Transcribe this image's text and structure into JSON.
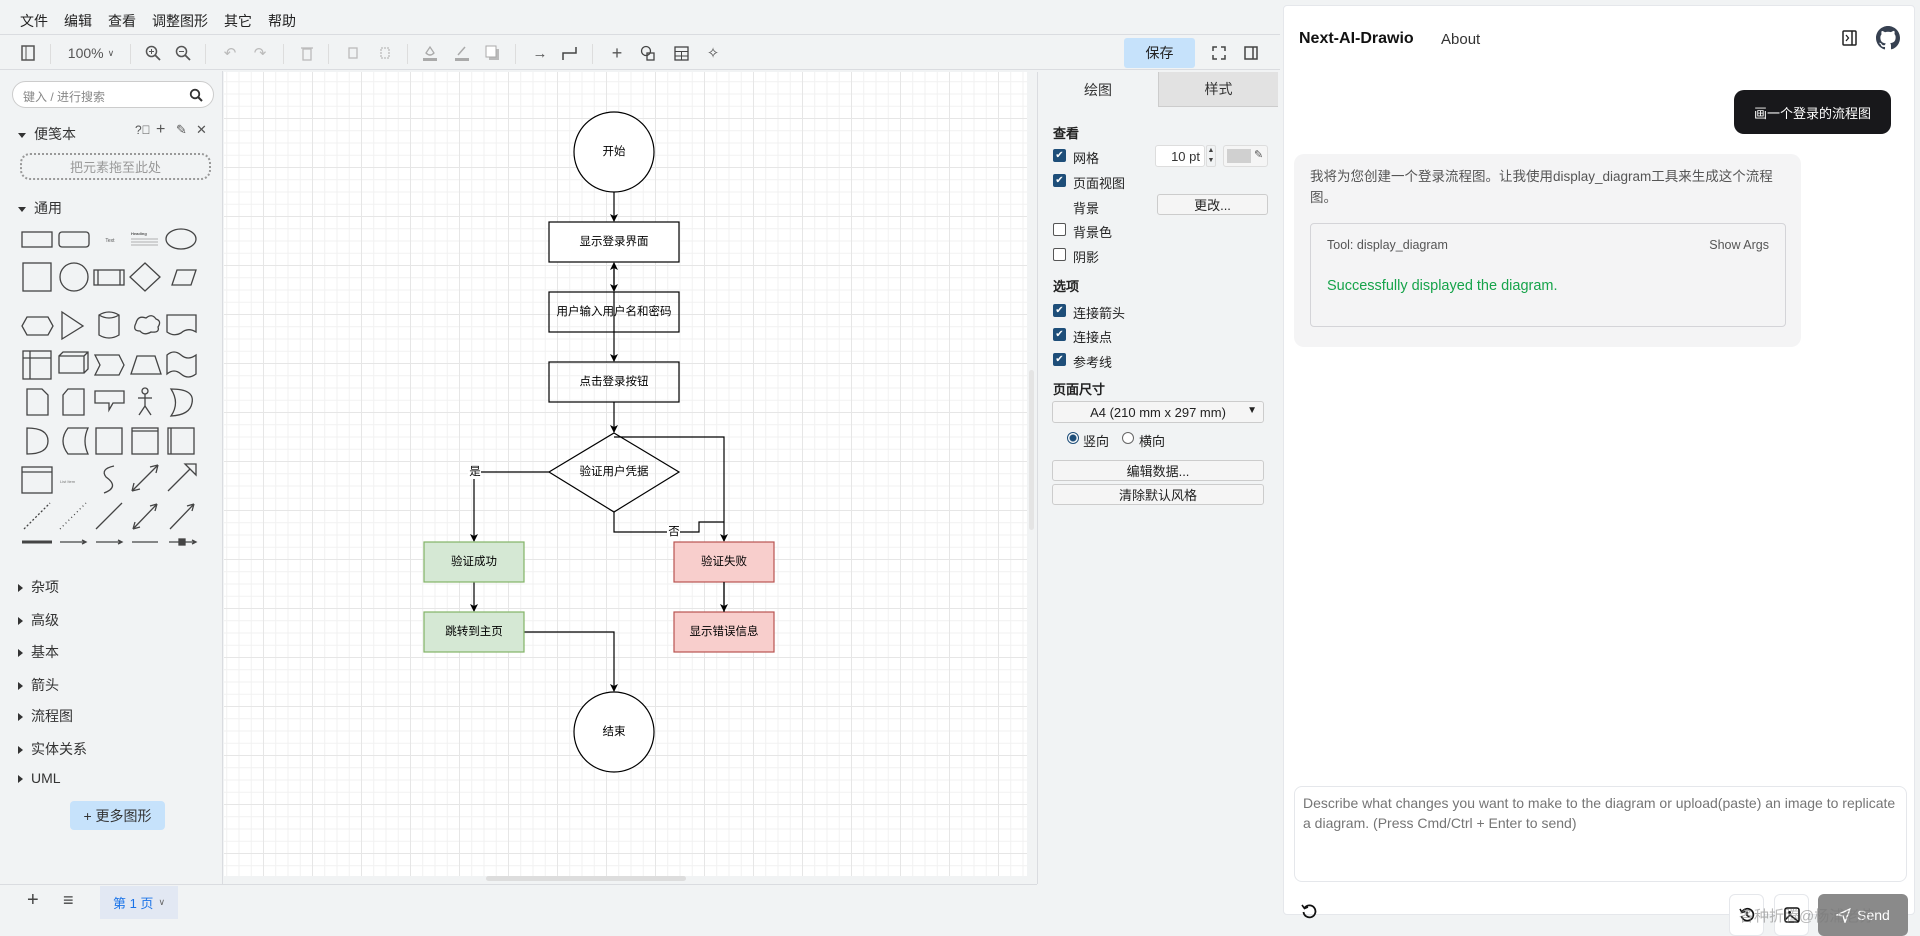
{
  "menu": [
    "文件",
    "编辑",
    "查看",
    "调整图形",
    "其它",
    "帮助"
  ],
  "toolbar": {
    "zoom": "100%",
    "save_label": "保存",
    "icons": [
      "sidebar-toggle-icon",
      "zoom-in-icon",
      "zoom-out-icon",
      "undo-icon",
      "redo-icon",
      "delete-icon",
      "to-front-icon",
      "to-back-icon",
      "fill-color-icon",
      "line-color-icon",
      "shadow-icon",
      "connection-arrow-icon",
      "waypoint-icon",
      "insert-icon",
      "shapes-icon",
      "table-icon",
      "ai-sparkle-icon",
      "fullscreen-icon",
      "format-panel-icon"
    ]
  },
  "sidebar": {
    "search_placeholder": "键入 / 进行搜索",
    "scratchpad": "便笺本",
    "dropzone": "把元素拖至此处",
    "general": "通用",
    "palette_text": "Text",
    "palette_heading": "Heading",
    "palette_list_item": "List Item",
    "collapsed_sections": [
      "杂项",
      "高级",
      "基本",
      "箭头",
      "流程图",
      "实体关系",
      "UML"
    ],
    "more_shapes": "+ 更多图形"
  },
  "footer": {
    "page_tab": "第 1 页"
  },
  "diagram": {
    "nodes": {
      "start": "开始",
      "show_login": "显示登录界面",
      "input_credentials": "用户输入用户名和密码",
      "click_login": "点击登录按钮",
      "verify": "验证用户凭据",
      "success": "验证成功",
      "goto_home": "跳转到主页",
      "fail": "验证失败",
      "show_error": "显示错误信息",
      "end": "结束"
    },
    "edge_labels": {
      "yes": "是",
      "no": "否"
    },
    "colors": {
      "success_fill": "#d5e8d4",
      "success_stroke": "#82b366",
      "fail_fill": "#f8cecc",
      "fail_stroke": "#b85450"
    }
  },
  "format_panel": {
    "tabs": [
      "绘图",
      "样式"
    ],
    "view_heading": "查看",
    "grid": {
      "label": "网格",
      "checked": true,
      "size": "10 pt",
      "color": "#d0d0d0"
    },
    "page_view": {
      "label": "页面视图",
      "checked": true
    },
    "background": {
      "label": "背景",
      "button": "更改..."
    },
    "background_color": {
      "label": "背景色",
      "checked": false
    },
    "shadow": {
      "label": "阴影",
      "checked": false
    },
    "options_heading": "选项",
    "connection_arrows": {
      "label": "连接箭头",
      "checked": true
    },
    "connection_points": {
      "label": "连接点",
      "checked": true
    },
    "guides": {
      "label": "参考线",
      "checked": true
    },
    "page_size_heading": "页面尺寸",
    "page_size": "A4 (210 mm x 297 mm)",
    "portrait": "竖向",
    "landscape": "横向",
    "orientation": "portrait",
    "edit_data": "编辑数据...",
    "clear_style": "清除默认风格"
  },
  "chat": {
    "title": "Next-AI-Drawio",
    "about": "About",
    "user_message": "画一个登录的流程图",
    "assistant_message": "我将为您创建一个登录流程图。让我使用display_diagram工具来生成这个流程图。",
    "tool_name": "Tool: display_diagram",
    "show_args": "Show Args",
    "tool_result": "Successfully displayed the diagram.",
    "input_placeholder": "Describe what changes you want to make to the diagram or upload(paste) an image to replicate a diagram. (Press Cmd/Ctrl + Enter to send)",
    "send": "Send",
    "watermark": "各种折腾@杨浦老苏",
    "success_color": "#16a34a"
  }
}
